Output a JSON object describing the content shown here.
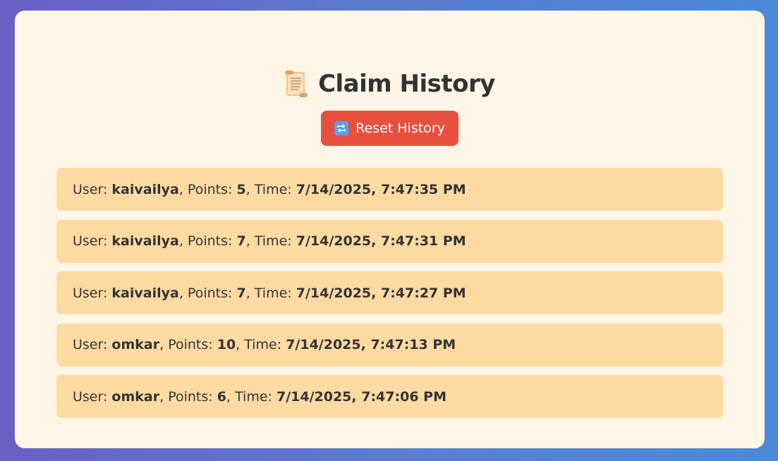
{
  "header": {
    "icon": "scroll-icon",
    "title": "Claim History"
  },
  "reset_button": {
    "icon": "repeat-icon",
    "label": "Reset History"
  },
  "labels": {
    "user": "User: ",
    "points": ", Points: ",
    "time": ", Time: "
  },
  "history": [
    {
      "user": "kaivailya",
      "points": "5",
      "time": "7/14/2025, 7:47:35 PM"
    },
    {
      "user": "kaivailya",
      "points": "7",
      "time": "7/14/2025, 7:47:31 PM"
    },
    {
      "user": "kaivailya",
      "points": "7",
      "time": "7/14/2025, 7:47:27 PM"
    },
    {
      "user": "omkar",
      "points": "10",
      "time": "7/14/2025, 7:47:13 PM"
    },
    {
      "user": "omkar",
      "points": "6",
      "time": "7/14/2025, 7:47:06 PM"
    }
  ],
  "colors": {
    "card_background": "#fff6e8",
    "entry_background": "#ffdba3",
    "reset_button": "#e8503e",
    "text": "#333333"
  }
}
